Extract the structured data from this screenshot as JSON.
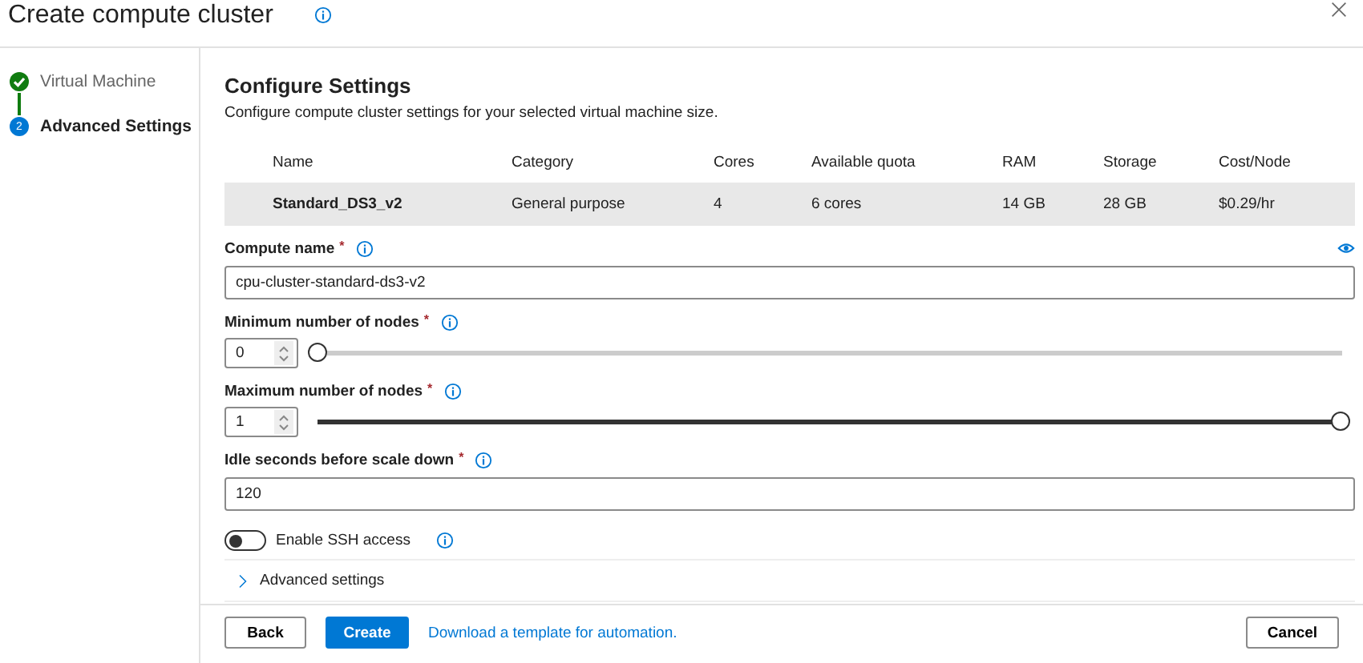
{
  "window": {
    "title": "Create compute cluster"
  },
  "steps": [
    {
      "label": "Virtual Machine",
      "completed": true,
      "selected": false
    },
    {
      "label": "Advanced Settings",
      "completed": false,
      "selected": true,
      "number": "2"
    }
  ],
  "section": {
    "title": "Configure Settings",
    "description": "Configure compute cluster settings for your selected virtual machine size."
  },
  "table": {
    "columns": [
      "Name",
      "Category",
      "Cores",
      "Available quota",
      "RAM",
      "Storage",
      "Cost/Node"
    ],
    "rows": [
      {
        "selected": true,
        "cells": [
          "Standard_DS3_v2",
          "General purpose",
          "4",
          "6 cores",
          "14 GB",
          "28 GB",
          "$0.29/hr"
        ]
      }
    ]
  },
  "fields": [
    {
      "kind": "text",
      "label": "Compute name",
      "required_mark": "*",
      "value": "cpu-cluster-standard-ds3-v2"
    },
    {
      "kind": "number_slider",
      "label": "Minimum number of nodes",
      "required_mark": "*",
      "value": "0",
      "level": 0
    },
    {
      "kind": "number_slider",
      "label": "Maximum number of nodes",
      "required_mark": "*",
      "value": "1",
      "level": 1
    },
    {
      "kind": "text",
      "label": "Idle seconds before scale down",
      "required_mark": "*",
      "value": "120"
    },
    {
      "kind": "toggle",
      "label": "Enable SSH access",
      "on": false
    }
  ],
  "advanced": {
    "label": "Advanced settings",
    "expanded": false
  },
  "footer": {
    "back": "Back",
    "create": "Create",
    "link": "Download a template for automation.",
    "cancel": "Cancel"
  }
}
